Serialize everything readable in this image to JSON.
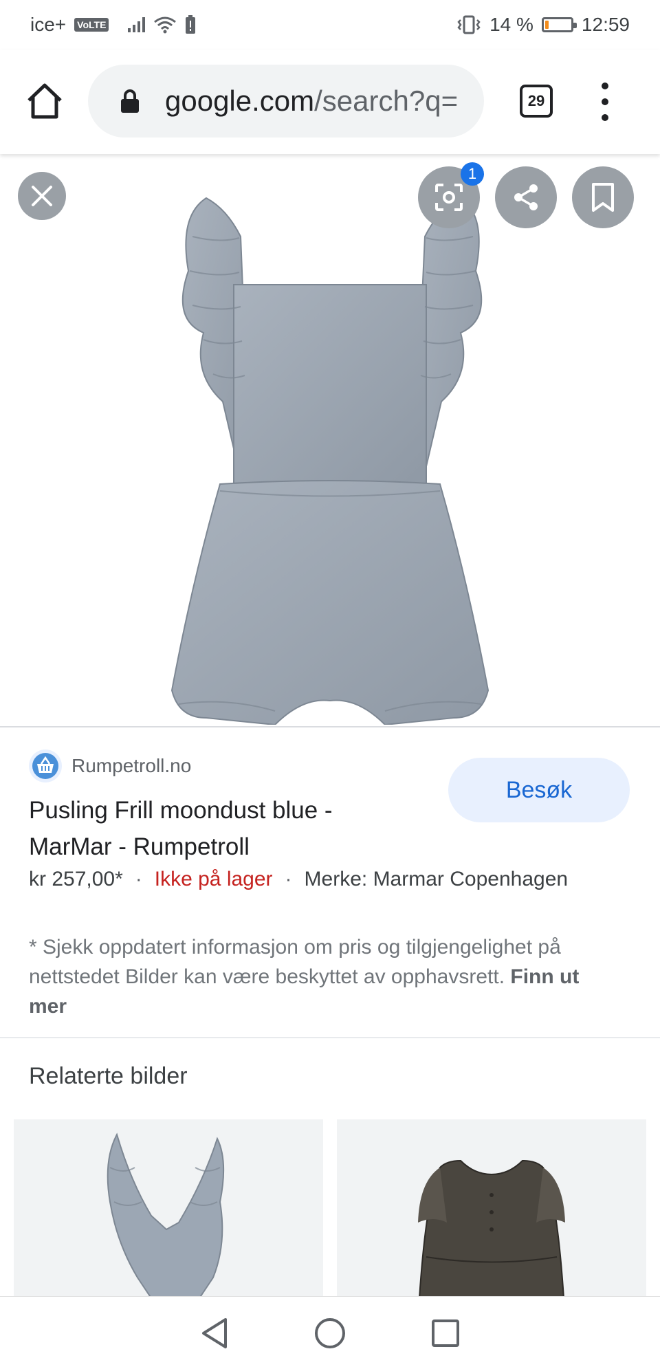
{
  "status": {
    "carrier": "ice+",
    "volte": "VoLTE",
    "battery_percent": "14 %",
    "battery_level": 0.14,
    "time": "12:59"
  },
  "browser": {
    "url_domain": "google.com",
    "url_path": "/search?q=",
    "tab_count": "29"
  },
  "viewer": {
    "lens_badge": "1"
  },
  "result": {
    "source": "Rumpetroll.no",
    "visit_label": "Besøk",
    "title": "Pusling Frill moondust blue - MarMar - Rumpetroll",
    "price": "kr 257,00*",
    "separator": "·",
    "stock": "Ikke på lager",
    "brand": "Merke: Marmar Copenhagen",
    "disclaimer": "* Sjekk oppdatert informasjon om pris og tilgjengelighet på nettstedet Bilder kan være beskyttet av opphavsrett.",
    "learn_more": "Finn ut mer"
  },
  "related": {
    "title": "Relaterte bilder"
  },
  "colors": {
    "accent": "#1a73e8",
    "visit_bg": "#e8f0fe",
    "stock_red": "#c5221f",
    "garment_blue_gray": "#9ca7b4"
  },
  "icons": [
    "home-icon",
    "lock-icon",
    "tabs-icon",
    "more-vert-icon",
    "close-icon",
    "lens-icon",
    "share-icon",
    "bookmark-icon",
    "back-icon",
    "home-circle-icon",
    "recents-icon"
  ]
}
